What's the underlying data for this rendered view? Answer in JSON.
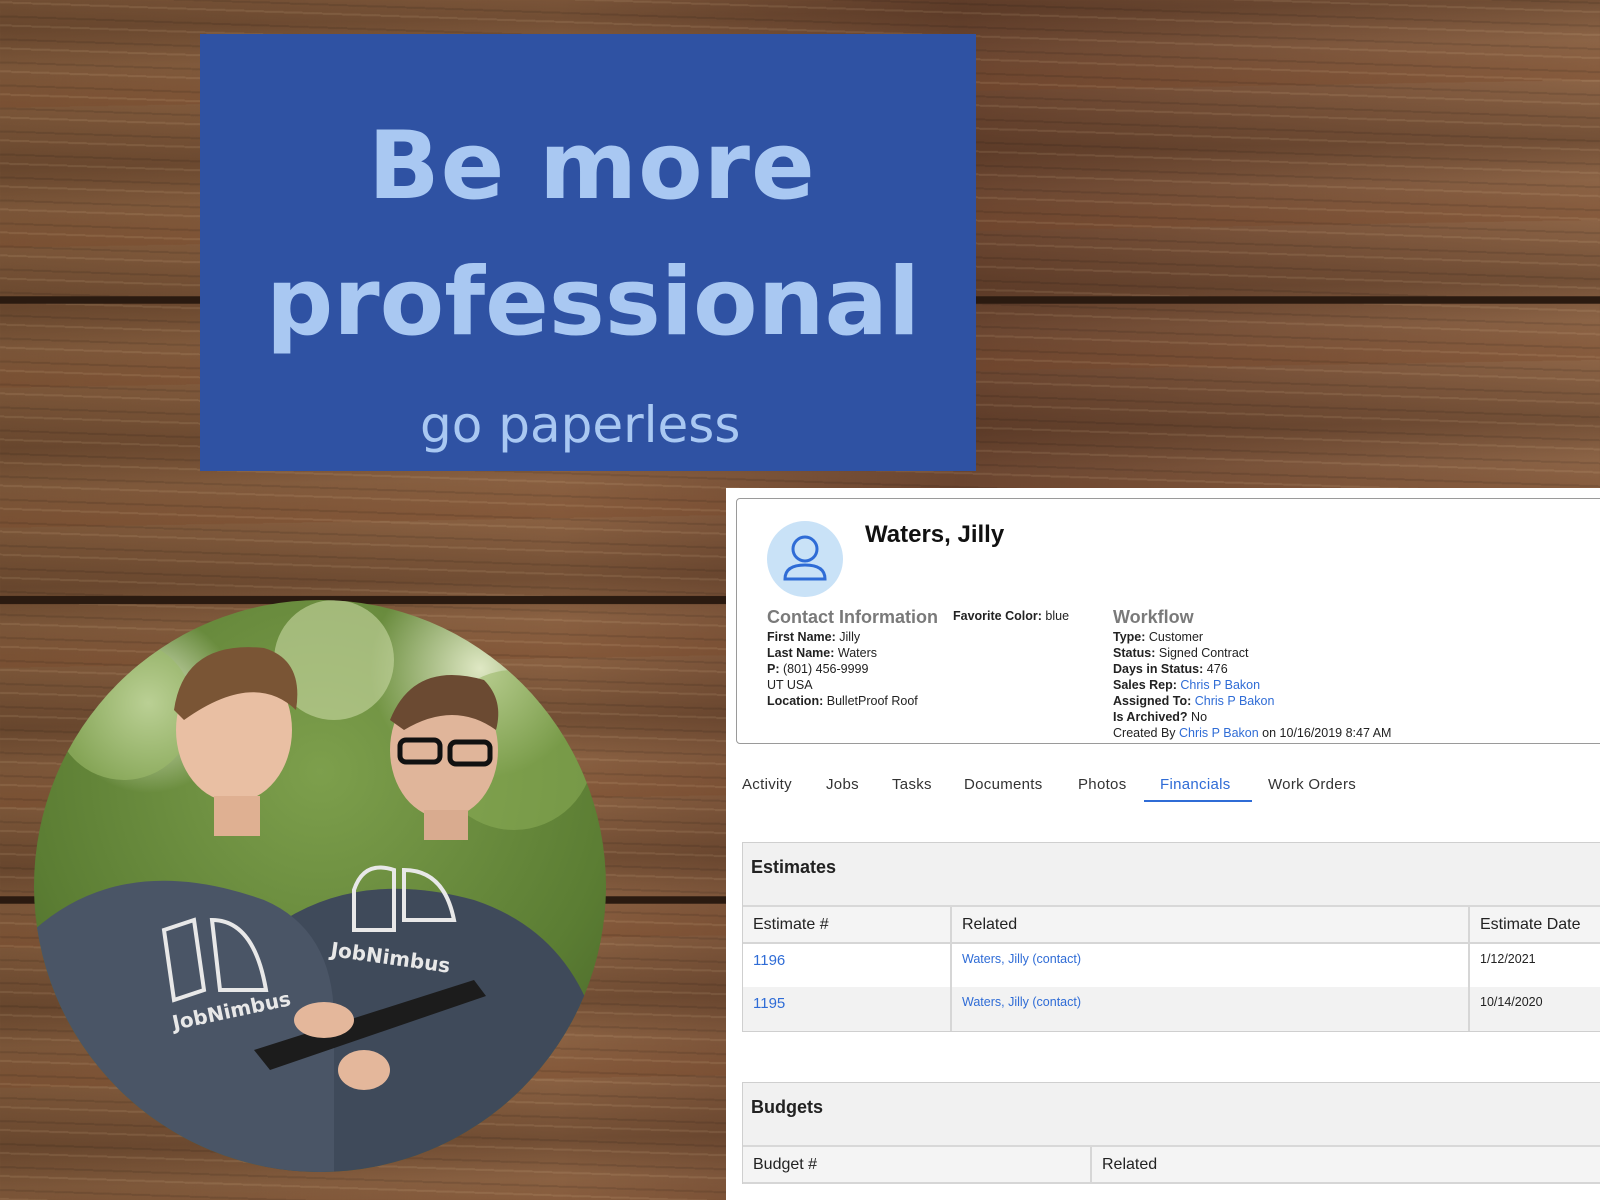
{
  "banner": {
    "line1": "Be more",
    "line2": "professional",
    "sub": "go paperless"
  },
  "photo": {
    "shirt_text_left": "JobNimbus",
    "shirt_text_right": "JobNimbus"
  },
  "colors": {
    "banner_bg": "#2f52a3",
    "banner_text": "#a9c8f2",
    "link": "#2f6cd6"
  },
  "contact": {
    "name": "Waters, Jilly",
    "contact_info_heading": "Contact Information",
    "first_name_label": "First Name:",
    "first_name": "Jilly",
    "last_name_label": "Last Name:",
    "last_name": "Waters",
    "phone_label": "P:",
    "phone": "(801) 456-9999",
    "region": "UT USA",
    "location_label": "Location:",
    "location": "BulletProof Roof",
    "favorite_color_label": "Favorite Color:",
    "favorite_color": "blue"
  },
  "workflow": {
    "heading": "Workflow",
    "type_label": "Type:",
    "type": "Customer",
    "status_label": "Status:",
    "status": "Signed Contract",
    "days_label": "Days in Status:",
    "days": "476",
    "sales_rep_label": "Sales Rep:",
    "sales_rep": "Chris P Bakon",
    "assigned_label": "Assigned To:",
    "assigned": "Chris P Bakon",
    "archived_label": "Is Archived?",
    "archived": "No",
    "created_prefix": "Created By",
    "created_by": "Chris P Bakon",
    "created_suffix": "on 10/16/2019 8:47 AM"
  },
  "tabs": [
    {
      "label": "Activity"
    },
    {
      "label": "Jobs"
    },
    {
      "label": "Tasks"
    },
    {
      "label": "Documents"
    },
    {
      "label": "Photos"
    },
    {
      "label": "Financials"
    },
    {
      "label": "Work Orders"
    }
  ],
  "estimates": {
    "title": "Estimates",
    "columns": [
      "Estimate #",
      "Related",
      "Estimate Date"
    ],
    "rows": [
      {
        "number": "1196",
        "related": "Waters, Jilly (contact)",
        "date": "1/12/2021"
      },
      {
        "number": "1195",
        "related": "Waters, Jilly (contact)",
        "date": "10/14/2020"
      }
    ]
  },
  "budgets": {
    "title": "Budgets",
    "columns": [
      "Budget #",
      "Related"
    ]
  }
}
